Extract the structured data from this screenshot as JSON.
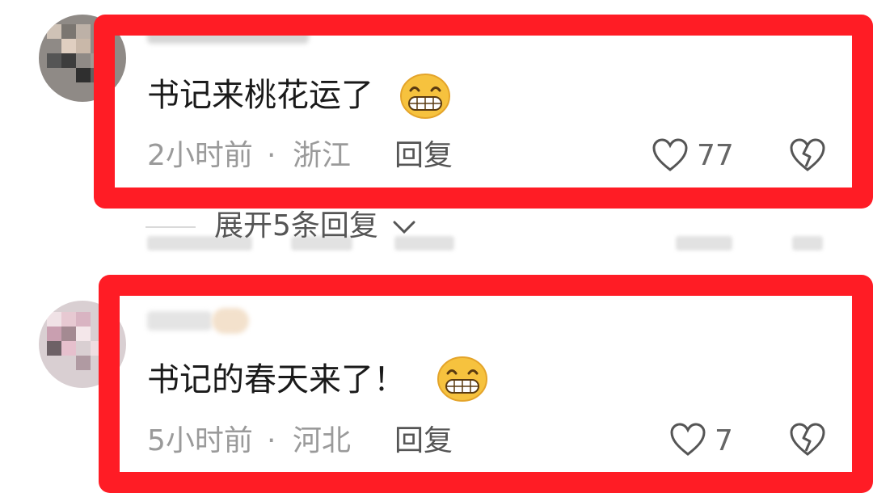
{
  "comments": [
    {
      "text": "书记来桃花运了",
      "emoji": "grinning-face",
      "time": "2小时前",
      "separator": "·",
      "location": "浙江",
      "reply_label": "回复",
      "likes": "77"
    },
    {
      "text": "书记的春天来了！",
      "emoji": "grinning-face",
      "time": "5小时前",
      "separator": "·",
      "location": "河北",
      "reply_label": "回复",
      "likes": "7"
    }
  ],
  "expand_replies": "展开5条回复",
  "colors": {
    "highlight": "#ff1c25",
    "meta_text": "#9a9a9a",
    "body_text": "#1a1a1a",
    "emoji_face": "#f6c23e"
  }
}
